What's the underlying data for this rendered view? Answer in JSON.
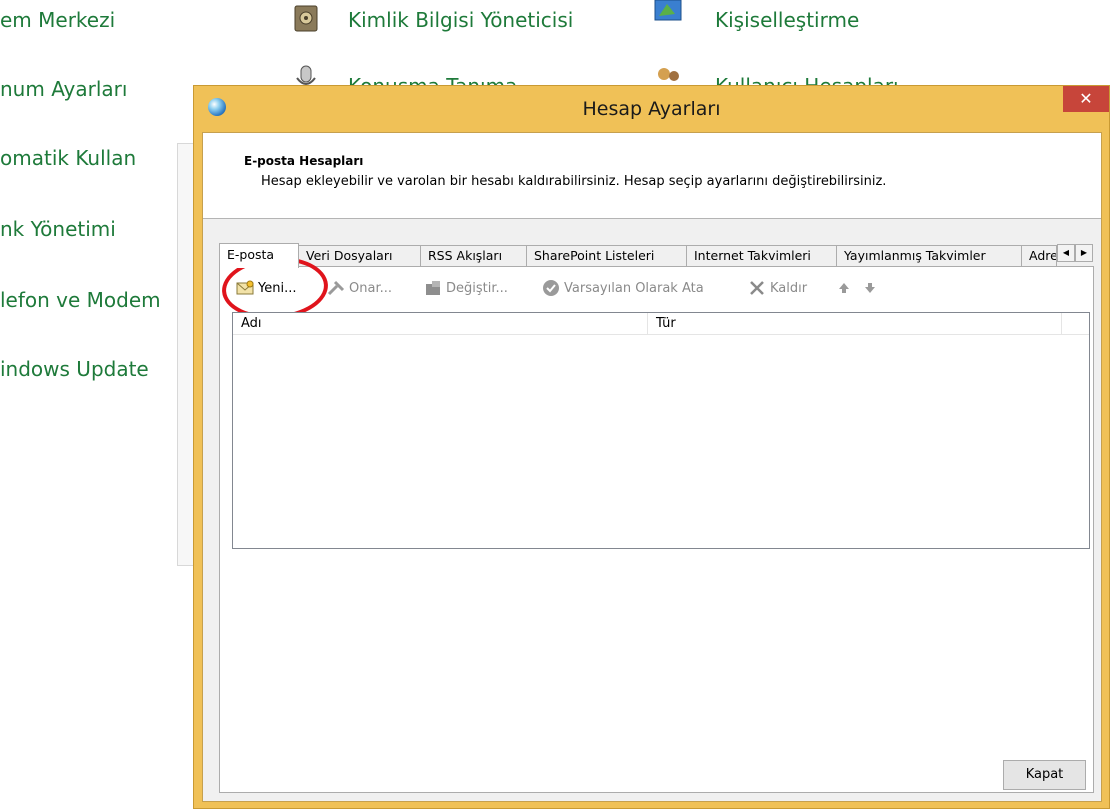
{
  "control_panel": {
    "left_items": [
      "em Merkezi",
      "num Ayarları",
      "omatik Kullan",
      "nk Yönetimi",
      "lefon ve Modem",
      "indows Update"
    ],
    "middle_items": [
      "Kimlik Bilgisi Yöneticisi",
      "Konuşma Tanıma"
    ],
    "right_items": [
      "Kişiselleştirme",
      "Kullanıcı Hesapları"
    ]
  },
  "dialog": {
    "title": "Hesap Ayarları",
    "close_glyph": "✕",
    "header_title": "E-posta Hesapları",
    "header_description": "Hesap ekleyebilir ve varolan bir hesabı kaldırabilirsiniz. Hesap seçip ayarlarını değiştirebilirsiniz.",
    "tabs": [
      "E-posta",
      "Veri Dosyaları",
      "RSS Akışları",
      "SharePoint Listeleri",
      "Internet Takvimleri",
      "Yayımlanmış Takvimler",
      "Adres"
    ],
    "tab_scroll_left": "◀",
    "tab_scroll_right": "▶",
    "toolbar": {
      "new": "Yeni...",
      "repair": "Onar...",
      "change": "Değiştir...",
      "set_default": "Varsayılan Olarak Ata",
      "remove": "Kaldır"
    },
    "columns": [
      "Adı",
      "Tür"
    ],
    "close_button": "Kapat"
  },
  "colors": {
    "window_frame": "#f0c157",
    "close_button": "#c7453a",
    "link_green": "#1e7a3a",
    "annotation_red": "#e0141c"
  }
}
